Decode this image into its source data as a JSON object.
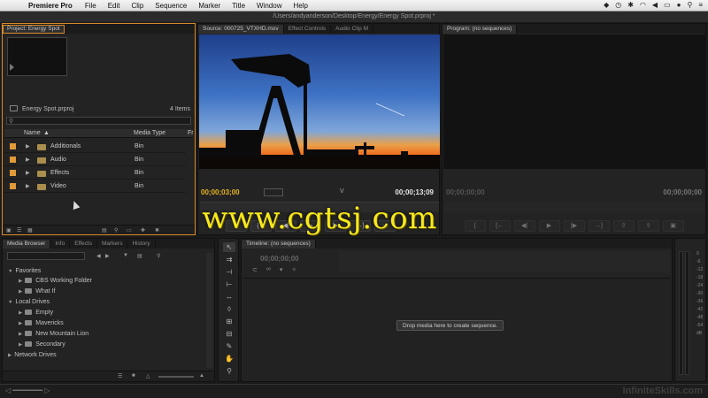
{
  "menubar": {
    "app_name": "Premiere Pro",
    "items": [
      "File",
      "Edit",
      "Clip",
      "Sequence",
      "Marker",
      "Title",
      "Window",
      "Help"
    ]
  },
  "window_title": "/Users/andyanderson/Desktop/Energy/Energy Spot.prproj *",
  "project_panel": {
    "tab": "Project: Energy Spot",
    "project_name": "Energy Spot.prproj",
    "item_count": "4 Items",
    "columns": {
      "name": "Name",
      "media_type": "Media Type",
      "extra": "Fr"
    },
    "rows": [
      {
        "name": "Additionals",
        "type": "Bin"
      },
      {
        "name": "Audio",
        "type": "Bin"
      },
      {
        "name": "Effects",
        "type": "Bin"
      },
      {
        "name": "Video",
        "type": "Bin"
      }
    ]
  },
  "source_monitor": {
    "tabs": [
      "Source: 000725_VTXHD.mov",
      "Effect Controls",
      "Audio Clip M"
    ],
    "timecode_in": "00;00;03;00",
    "timecode_out": "00;00;13;09",
    "track_label": "V",
    "watermark": "www.cgtsj.com"
  },
  "program_monitor": {
    "tab": "Program: (no sequences)",
    "timecode_left": "00;00;00;00",
    "timecode_right": "00;00;00;00"
  },
  "media_browser": {
    "tabs": [
      "Media Browser",
      "Info",
      "Effects",
      "Markers",
      "History"
    ],
    "favorites_label": "Favorites",
    "favorites": [
      "CBS Working Folder",
      "What If"
    ],
    "local_drives_label": "Local Drives",
    "local_drives": [
      "Empty",
      "Mavericks",
      "New Mountain Lion",
      "Secondary"
    ],
    "network_label": "Network Drives"
  },
  "timeline": {
    "tab": "Timeline: (no sequences)",
    "timecode": "00;00;00;00",
    "drop_message": "Drop media here to create sequence."
  },
  "meter_scale": [
    "0",
    "-6",
    "-12",
    "-18",
    "-24",
    "-30",
    "-36",
    "-42",
    "-48",
    "-54",
    "dB"
  ],
  "footer_watermark": "InfiniteSkills.com"
}
